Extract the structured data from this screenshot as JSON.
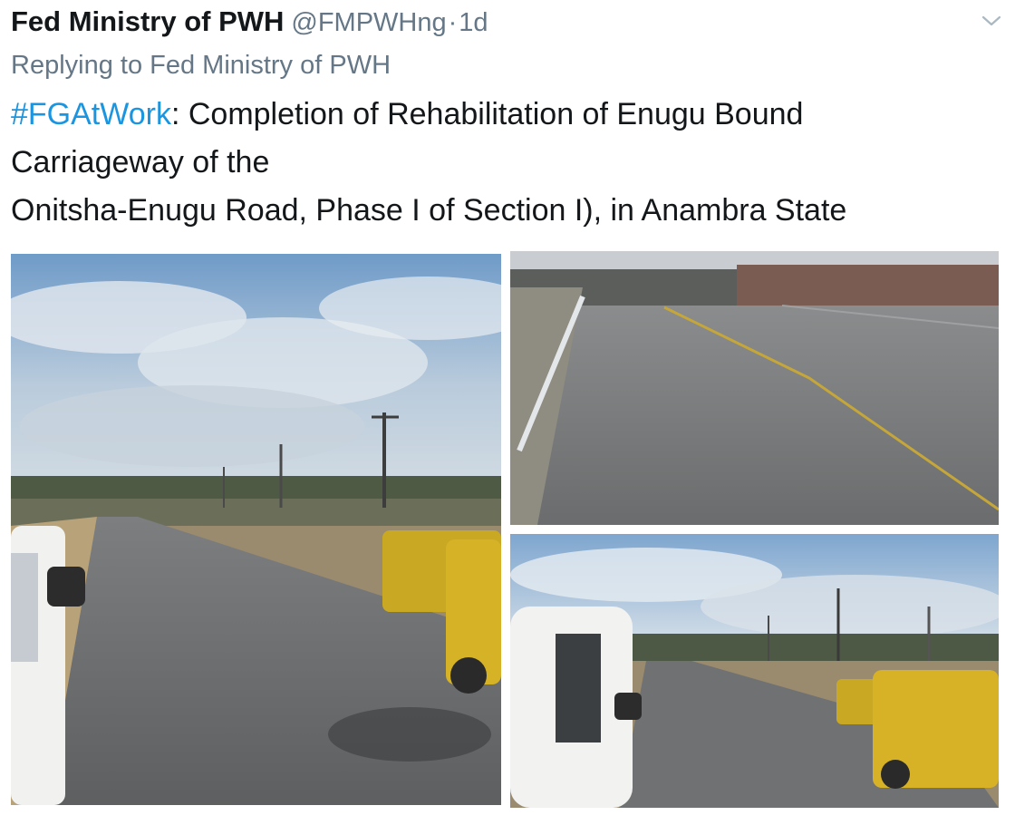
{
  "tweet": {
    "author_name": "Fed Ministry of PWH",
    "handle": "@FMPWHng",
    "separator": "·",
    "time": "1d",
    "replying_to": "Replying to Fed Ministry of PWH",
    "hashtag": "#FGAtWork",
    "text_line1": ": Completion of Rehabilitation of Enugu Bound",
    "text_line2": "Carriageway of the",
    "text_line3": "Onitsha-Enugu Road, Phase I of Section I), in Anambra State"
  },
  "icons": {
    "more": "chevron-down-icon"
  },
  "colors": {
    "text": "#14171a",
    "secondary": "#657786",
    "link": "#1b95e0"
  },
  "media": {
    "count": 3
  }
}
